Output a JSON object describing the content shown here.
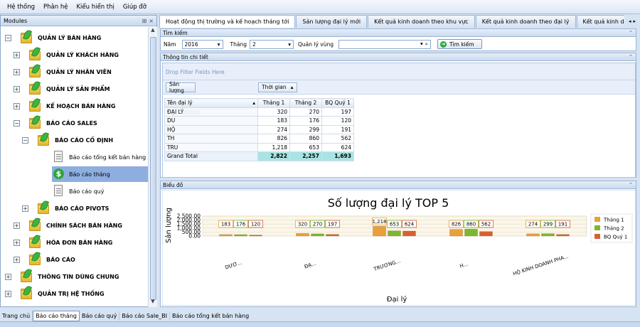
{
  "menu": [
    "Hệ thống",
    "Phân hệ",
    "Kiểu hiển thị",
    "Giúp đỡ"
  ],
  "left_panel": {
    "title": "Modules",
    "tree": [
      {
        "label": "QUẢN LÝ BÁN HÀNG",
        "level": 0,
        "kind": "folder",
        "expander": "−"
      },
      {
        "label": "QUẢN LÝ KHÁCH HÀNG",
        "level": 1,
        "kind": "folder",
        "expander": "+"
      },
      {
        "label": "QUẢN LÝ NHÂN VIÊN",
        "level": 1,
        "kind": "folder",
        "expander": "+"
      },
      {
        "label": "QUẢN LÝ SẢN PHẨM",
        "level": 1,
        "kind": "folder",
        "expander": "+"
      },
      {
        "label": "KẾ HOẠCH BÁN HÀNG",
        "level": 1,
        "kind": "folder",
        "expander": "+"
      },
      {
        "label": "BÁO CÁO SALES",
        "level": 1,
        "kind": "folder",
        "expander": "−"
      },
      {
        "label": "BÁO CÁO CỐ ĐỊNH",
        "level": 2,
        "kind": "folder",
        "expander": "−"
      },
      {
        "label": "Báo cáo tổng kết bán hàng",
        "level": 3,
        "kind": "doc",
        "expander": ""
      },
      {
        "label": "Báo cáo tháng",
        "level": 3,
        "kind": "money",
        "expander": "",
        "selected": true
      },
      {
        "label": "Báo cáo quý",
        "level": 3,
        "kind": "doc",
        "expander": ""
      },
      {
        "label": "BÁO CÁO PIVOTS",
        "level": 2,
        "kind": "folder",
        "expander": "+"
      },
      {
        "label": "CHÍNH SÁCH BÁN HÀNG",
        "level": 1,
        "kind": "folder",
        "expander": "+"
      },
      {
        "label": "HÓA ĐƠN BÁN HÀNG",
        "level": 1,
        "kind": "folder",
        "expander": "+"
      },
      {
        "label": "BÁO CÁO",
        "level": 1,
        "kind": "folder",
        "expander": "+"
      },
      {
        "label": "THÔNG TIN DÙNG CHUNG",
        "level": 0,
        "kind": "folder",
        "expander": "+"
      },
      {
        "label": "QUẢN TRỊ HỆ THỐNG",
        "level": 0,
        "kind": "folder",
        "expander": "+"
      }
    ]
  },
  "tabs": [
    "Hoạt động thị trường và kế hoạch tháng tới",
    "Sản lượng đại lý mới",
    "Kết quả kinh doanh theo khu vực",
    "Kết quả kinh doanh theo đại lý",
    "Kết quả kinh doanh"
  ],
  "search": {
    "header": "Tìm kiếm",
    "year_label": "Năm",
    "year_value": "2016",
    "month_label": "Tháng",
    "month_value": "2",
    "region_label": "Quản lý vùng",
    "region_value": "",
    "button": "Tìm kiếm"
  },
  "detail": {
    "header": "Thông tin chi tiết",
    "filter_placeholder": "Drop Filter Fields Here",
    "data_field": "Sản lượng",
    "column_field": "Thời gian",
    "row_field": "Tên đại lý",
    "columns": [
      "Tháng 1",
      "Tháng 2",
      "BQ Quý 1"
    ],
    "rows": [
      {
        "name": "ĐẠI LÝ",
        "values": [
          "320",
          "270",
          "197"
        ]
      },
      {
        "name": "DU",
        "values": [
          "183",
          "176",
          "120"
        ]
      },
      {
        "name": "HỘ",
        "values": [
          "274",
          "299",
          "191"
        ]
      },
      {
        "name": "TH",
        "values": [
          "826",
          "860",
          "562"
        ]
      },
      {
        "name": "TRU",
        "values": [
          "1,218",
          "653",
          "624"
        ]
      }
    ],
    "grand_total_label": "Grand Total",
    "grand_total": [
      "2,822",
      "2,257",
      "1,693"
    ]
  },
  "chart_panel": {
    "header": "Biểu đồ"
  },
  "chart_data": {
    "type": "bar",
    "title": "Số lượng đại lý TOP 5",
    "xlabel": "Đại lý",
    "ylabel": "Sản lượng",
    "categories": [
      "DƯƠ...",
      "ĐẠ...",
      "TRƯƠNG...",
      "H...",
      "HỘ KINH DOANH PHA..."
    ],
    "series": [
      {
        "name": "Tháng 1",
        "values": [
          183,
          320,
          1218,
          826,
          274
        ],
        "color": "#e8a03c"
      },
      {
        "name": "Tháng 2",
        "values": [
          176,
          270,
          653,
          860,
          299
        ],
        "color": "#7cb82e"
      },
      {
        "name": "BQ Quý 1",
        "values": [
          120,
          197,
          624,
          562,
          191
        ],
        "color": "#d95f33"
      }
    ],
    "yticks": [
      "2,500.00",
      "2,000.00",
      "1,500.00",
      "1,000.00",
      "500.00",
      "0.00"
    ],
    "ylim": [
      0,
      2500
    ],
    "legend": "right"
  },
  "bottom_tabs": [
    "Trang chủ",
    "Báo cáo tháng",
    "Báo cáo quý",
    "Báo cáo Sale_BI",
    "Báo cáo tổng kết bán hàng"
  ],
  "active_bottom_tab": 1
}
